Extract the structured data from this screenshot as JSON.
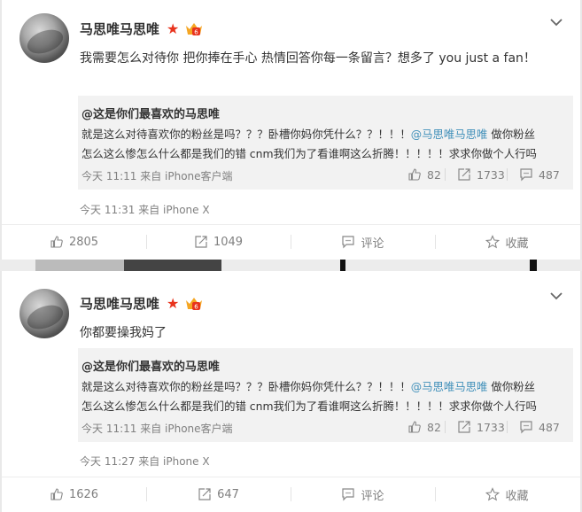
{
  "posts": [
    {
      "username": "马思唯马思唯",
      "text": "我需要怎么对待你 把你捧在手心 热情回答你每一条留言？想多了  you just a fan！",
      "quote": {
        "author": "@这是你们最喜欢的马思唯",
        "line1_a": "就是这么对待喜欢你的粉丝是吗？？？卧槽你妈你凭什么？？！！！",
        "line1_mention": "@马思唯马思唯",
        "line1_b": " 做你粉丝",
        "line2": "怎么这么惨怎么什么都是我们的错 cnm我们为了看谁啊这么折腾！！！！！求求你做个人行吗",
        "meta": "今天 11:11 来自 iPhone客户端",
        "likes": "82",
        "reposts": "1733",
        "comments": "487"
      },
      "meta": "今天 11:31 来自 iPhone X",
      "actions": {
        "likes": "2805",
        "reposts": "1049",
        "comment": "评论",
        "favorite": "收藏"
      }
    },
    {
      "username": "马思唯马思唯",
      "text": "你都要操我妈了",
      "quote": {
        "author": "@这是你们最喜欢的马思唯",
        "line1_a": "就是这么对待喜欢你的粉丝是吗？？？卧槽你妈你凭什么？？！！！",
        "line1_mention": "@马思唯马思唯",
        "line1_b": " 做你粉丝",
        "line2": "怎么这么惨怎么什么都是我们的错 cnm我们为了看谁啊这么折腾！！！！！求求你做个人行吗",
        "meta": "今天 11:11 来自 iPhone客户端",
        "likes": "82",
        "reposts": "1733",
        "comments": "487"
      },
      "meta": "今天 11:27 来自 iPhone X",
      "actions": {
        "likes": "1626",
        "reposts": "647",
        "comment": "评论",
        "favorite": "收藏"
      }
    }
  ],
  "colors": {
    "mention": "#3f8fb9",
    "star": "#e8331d",
    "badge": "#f5a623",
    "meta": "#808080"
  },
  "icons": [
    "star-icon",
    "vip-badge-icon",
    "chevron-down-icon",
    "thumbs-up-icon",
    "repost-icon",
    "comment-icon",
    "favorite-star-icon"
  ]
}
